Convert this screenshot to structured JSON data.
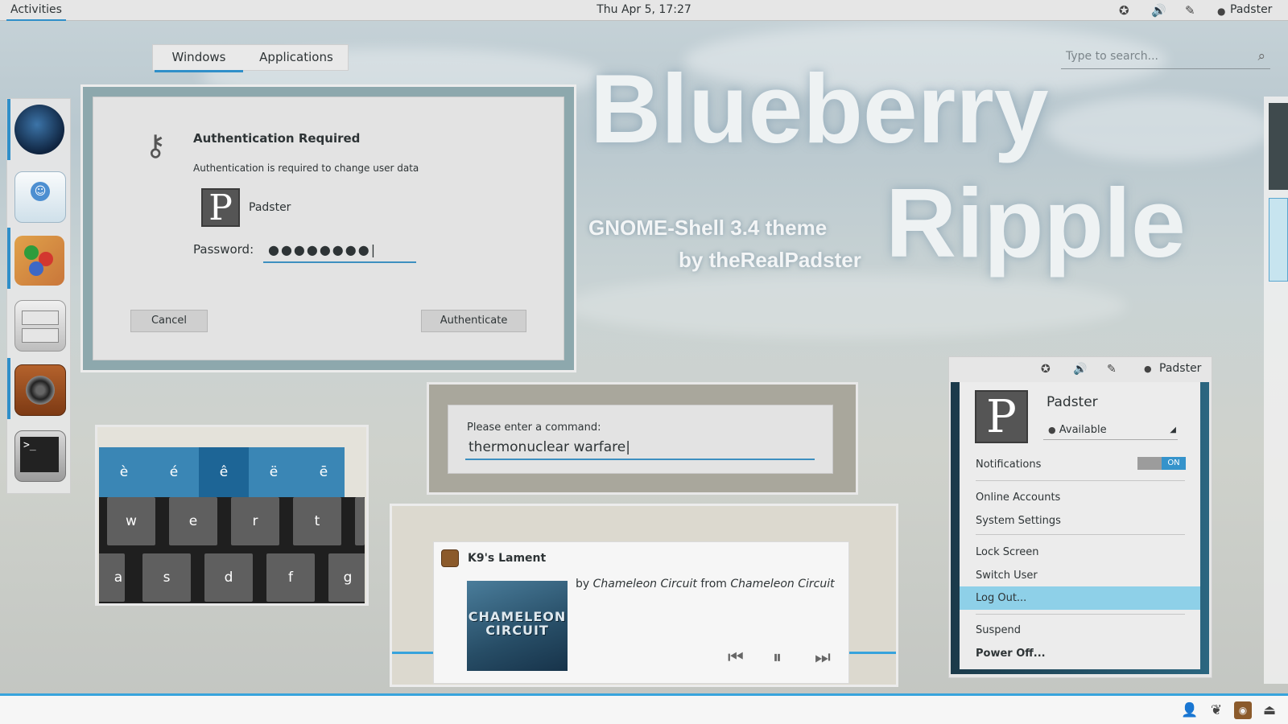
{
  "topbar": {
    "activities": "Activities",
    "clock": "Thu Apr  5, 17:27",
    "user": "Padster",
    "tray_icons": [
      "accessibility-icon",
      "volume-icon",
      "network-icon",
      "chat-status-icon"
    ]
  },
  "overview": {
    "tabs": [
      {
        "label": "Windows",
        "active": true
      },
      {
        "label": "Applications",
        "active": false
      }
    ],
    "search_placeholder": "Type to search..."
  },
  "title": {
    "line1": "Blueberry",
    "line2": "Ripple",
    "subtitle1": "GNOME-Shell 3.4 theme",
    "subtitle2": "by theRealPadster"
  },
  "dash": {
    "items": [
      "web-browser-icon",
      "empathy-chat-icon",
      "paint-icon",
      "file-cabinet-icon",
      "speaker-icon",
      "terminal-icon"
    ]
  },
  "auth": {
    "title": "Authentication Required",
    "message": "Authentication is required to change user data",
    "avatar_letter": "P",
    "user": "Padster",
    "password_label": "Password:",
    "password_value": "●●●●●●●●|",
    "cancel": "Cancel",
    "authenticate": "Authenticate"
  },
  "run": {
    "label": "Please enter a command:",
    "value": "thermonuclear warfare|"
  },
  "keyboard": {
    "accents": [
      "è",
      "é",
      "ê",
      "ë",
      "ē"
    ],
    "row1": [
      "w",
      "e",
      "r",
      "t"
    ],
    "row2": [
      "a",
      "s",
      "d",
      "f",
      "g"
    ]
  },
  "music": {
    "title": "K9's Lament",
    "by_prefix": "by",
    "artist": "Chameleon Circuit",
    "from": "from",
    "album": "Chameleon Circuit",
    "album_art_text_1": "CHAMELEON",
    "album_art_text_2": "CIRCUIT",
    "controls": [
      "previous-icon",
      "pause-icon",
      "next-icon"
    ]
  },
  "user_menu": {
    "bar_user": "Padster",
    "avatar_letter": "P",
    "name": "Padster",
    "status": "Available",
    "notifications": "Notifications",
    "toggle": "ON",
    "items": [
      "Online Accounts",
      "System Settings",
      "Lock Screen",
      "Switch User",
      "Log Out...",
      "Suspend",
      "Power Off..."
    ],
    "highlighted": "Log Out..."
  },
  "message_tray": {
    "icons": [
      "user-icon",
      "empathy-icon",
      "music-app-icon",
      "eject-icon"
    ]
  }
}
